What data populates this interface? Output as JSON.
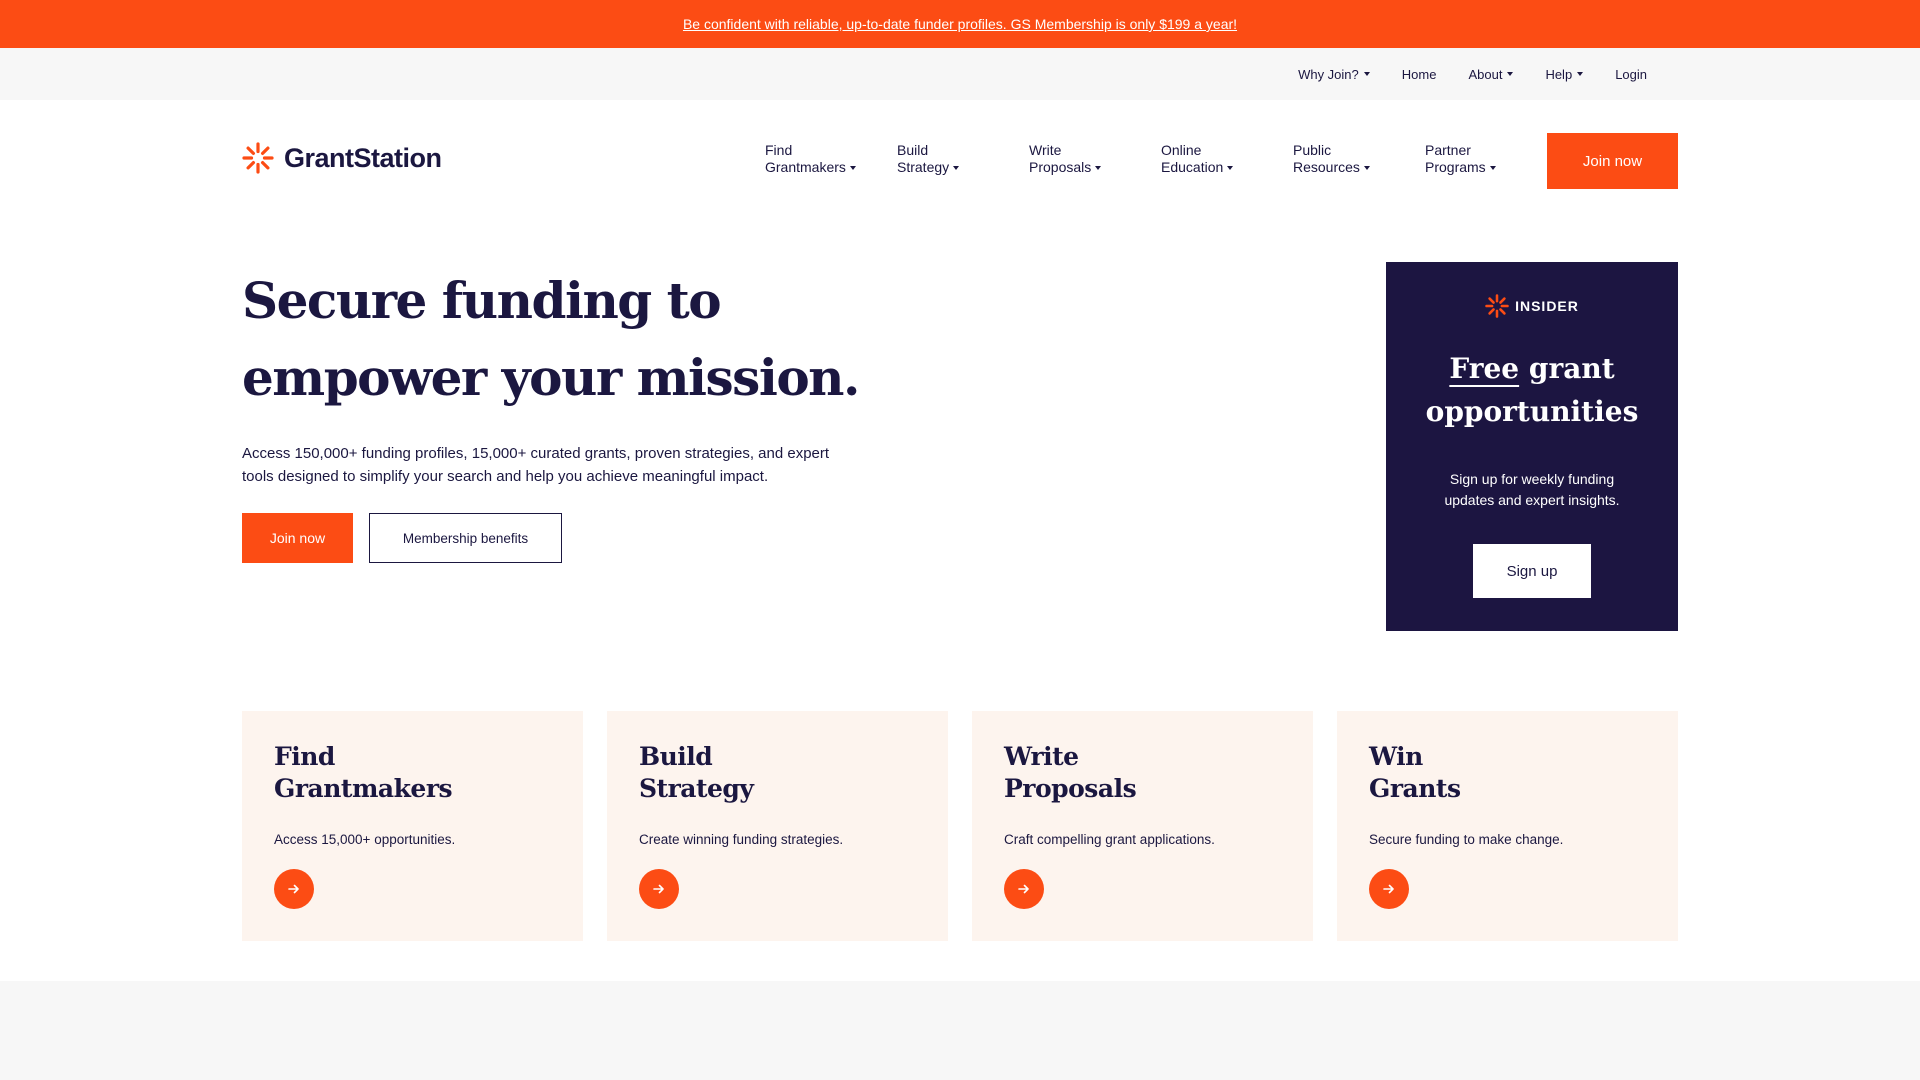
{
  "promo": {
    "text": "Be confident with reliable, up-to-date funder profiles. GS Membership is only $199 a year!"
  },
  "utility_nav": [
    {
      "label": "Why Join?",
      "has_dropdown": true
    },
    {
      "label": "Home",
      "has_dropdown": false
    },
    {
      "label": "About",
      "has_dropdown": true
    },
    {
      "label": "Help",
      "has_dropdown": true
    },
    {
      "label": "Login",
      "has_dropdown": false
    }
  ],
  "header": {
    "logo_text": "GrantStation",
    "logo_icon": "sunburst-icon",
    "nav": [
      {
        "line1": "Find",
        "line2": "Grantmakers"
      },
      {
        "line1": "Build",
        "line2": "Strategy"
      },
      {
        "line1": "Write",
        "line2": "Proposals"
      },
      {
        "line1": "Online",
        "line2": "Education"
      },
      {
        "line1": "Public",
        "line2": "Resources"
      },
      {
        "line1": "Partner",
        "line2": "Programs"
      }
    ],
    "join_label": "Join now"
  },
  "hero": {
    "title_line1": "Secure funding to",
    "title_line2": "empower your mission.",
    "subtitle": "Access 150,000+ funding profiles, 15,000+ curated grants, proven strategies, and expert tools designed to simplify your search and help you achieve meaningful impact.",
    "primary_label": "Join now",
    "secondary_label": "Membership benefits"
  },
  "insider": {
    "badge": "INSIDER",
    "title_free": "Free",
    "title_rest_line1": "grant",
    "title_line2": "opportunities",
    "description": "Sign up for weekly funding updates and expert insights.",
    "button_label": "Sign up"
  },
  "cards": [
    {
      "title_line1": "Find",
      "title_line2": "Grantmakers",
      "description": "Access 15,000+ opportunities.",
      "arrow_icon": "arrow-right-icon"
    },
    {
      "title_line1": "Build",
      "title_line2": "Strategy",
      "description": "Create winning funding strategies.",
      "arrow_icon": "arrow-right-icon"
    },
    {
      "title_line1": "Write",
      "title_line2": "Proposals",
      "description": "Craft compelling grant applications.",
      "arrow_icon": "arrow-right-icon"
    },
    {
      "title_line1": "Win",
      "title_line2": "Grants",
      "description": "Secure funding to make change.",
      "arrow_icon": "arrow-right-icon"
    }
  ],
  "colors": {
    "accent": "#fc4c14",
    "navy": "#1c1541",
    "card_bg": "#fdf4ee",
    "utility_bg": "#f7f7f7"
  }
}
